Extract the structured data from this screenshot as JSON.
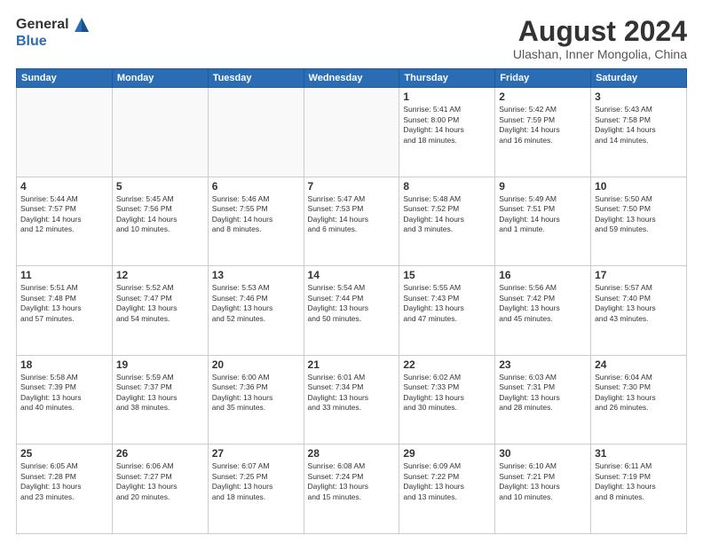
{
  "header": {
    "logo_general": "General",
    "logo_blue": "Blue",
    "month_title": "August 2024",
    "location": "Ulashan, Inner Mongolia, China"
  },
  "days_of_week": [
    "Sunday",
    "Monday",
    "Tuesday",
    "Wednesday",
    "Thursday",
    "Friday",
    "Saturday"
  ],
  "weeks": [
    [
      {
        "day": "",
        "empty": true
      },
      {
        "day": "",
        "empty": true
      },
      {
        "day": "",
        "empty": true
      },
      {
        "day": "",
        "empty": true
      },
      {
        "day": "1",
        "info": "Sunrise: 5:41 AM\nSunset: 8:00 PM\nDaylight: 14 hours\nand 18 minutes."
      },
      {
        "day": "2",
        "info": "Sunrise: 5:42 AM\nSunset: 7:59 PM\nDaylight: 14 hours\nand 16 minutes."
      },
      {
        "day": "3",
        "info": "Sunrise: 5:43 AM\nSunset: 7:58 PM\nDaylight: 14 hours\nand 14 minutes."
      }
    ],
    [
      {
        "day": "4",
        "info": "Sunrise: 5:44 AM\nSunset: 7:57 PM\nDaylight: 14 hours\nand 12 minutes."
      },
      {
        "day": "5",
        "info": "Sunrise: 5:45 AM\nSunset: 7:56 PM\nDaylight: 14 hours\nand 10 minutes."
      },
      {
        "day": "6",
        "info": "Sunrise: 5:46 AM\nSunset: 7:55 PM\nDaylight: 14 hours\nand 8 minutes."
      },
      {
        "day": "7",
        "info": "Sunrise: 5:47 AM\nSunset: 7:53 PM\nDaylight: 14 hours\nand 6 minutes."
      },
      {
        "day": "8",
        "info": "Sunrise: 5:48 AM\nSunset: 7:52 PM\nDaylight: 14 hours\nand 3 minutes."
      },
      {
        "day": "9",
        "info": "Sunrise: 5:49 AM\nSunset: 7:51 PM\nDaylight: 14 hours\nand 1 minute."
      },
      {
        "day": "10",
        "info": "Sunrise: 5:50 AM\nSunset: 7:50 PM\nDaylight: 13 hours\nand 59 minutes."
      }
    ],
    [
      {
        "day": "11",
        "info": "Sunrise: 5:51 AM\nSunset: 7:48 PM\nDaylight: 13 hours\nand 57 minutes."
      },
      {
        "day": "12",
        "info": "Sunrise: 5:52 AM\nSunset: 7:47 PM\nDaylight: 13 hours\nand 54 minutes."
      },
      {
        "day": "13",
        "info": "Sunrise: 5:53 AM\nSunset: 7:46 PM\nDaylight: 13 hours\nand 52 minutes."
      },
      {
        "day": "14",
        "info": "Sunrise: 5:54 AM\nSunset: 7:44 PM\nDaylight: 13 hours\nand 50 minutes."
      },
      {
        "day": "15",
        "info": "Sunrise: 5:55 AM\nSunset: 7:43 PM\nDaylight: 13 hours\nand 47 minutes."
      },
      {
        "day": "16",
        "info": "Sunrise: 5:56 AM\nSunset: 7:42 PM\nDaylight: 13 hours\nand 45 minutes."
      },
      {
        "day": "17",
        "info": "Sunrise: 5:57 AM\nSunset: 7:40 PM\nDaylight: 13 hours\nand 43 minutes."
      }
    ],
    [
      {
        "day": "18",
        "info": "Sunrise: 5:58 AM\nSunset: 7:39 PM\nDaylight: 13 hours\nand 40 minutes."
      },
      {
        "day": "19",
        "info": "Sunrise: 5:59 AM\nSunset: 7:37 PM\nDaylight: 13 hours\nand 38 minutes."
      },
      {
        "day": "20",
        "info": "Sunrise: 6:00 AM\nSunset: 7:36 PM\nDaylight: 13 hours\nand 35 minutes."
      },
      {
        "day": "21",
        "info": "Sunrise: 6:01 AM\nSunset: 7:34 PM\nDaylight: 13 hours\nand 33 minutes."
      },
      {
        "day": "22",
        "info": "Sunrise: 6:02 AM\nSunset: 7:33 PM\nDaylight: 13 hours\nand 30 minutes."
      },
      {
        "day": "23",
        "info": "Sunrise: 6:03 AM\nSunset: 7:31 PM\nDaylight: 13 hours\nand 28 minutes."
      },
      {
        "day": "24",
        "info": "Sunrise: 6:04 AM\nSunset: 7:30 PM\nDaylight: 13 hours\nand 26 minutes."
      }
    ],
    [
      {
        "day": "25",
        "info": "Sunrise: 6:05 AM\nSunset: 7:28 PM\nDaylight: 13 hours\nand 23 minutes."
      },
      {
        "day": "26",
        "info": "Sunrise: 6:06 AM\nSunset: 7:27 PM\nDaylight: 13 hours\nand 20 minutes."
      },
      {
        "day": "27",
        "info": "Sunrise: 6:07 AM\nSunset: 7:25 PM\nDaylight: 13 hours\nand 18 minutes."
      },
      {
        "day": "28",
        "info": "Sunrise: 6:08 AM\nSunset: 7:24 PM\nDaylight: 13 hours\nand 15 minutes."
      },
      {
        "day": "29",
        "info": "Sunrise: 6:09 AM\nSunset: 7:22 PM\nDaylight: 13 hours\nand 13 minutes."
      },
      {
        "day": "30",
        "info": "Sunrise: 6:10 AM\nSunset: 7:21 PM\nDaylight: 13 hours\nand 10 minutes."
      },
      {
        "day": "31",
        "info": "Sunrise: 6:11 AM\nSunset: 7:19 PM\nDaylight: 13 hours\nand 8 minutes."
      }
    ]
  ]
}
